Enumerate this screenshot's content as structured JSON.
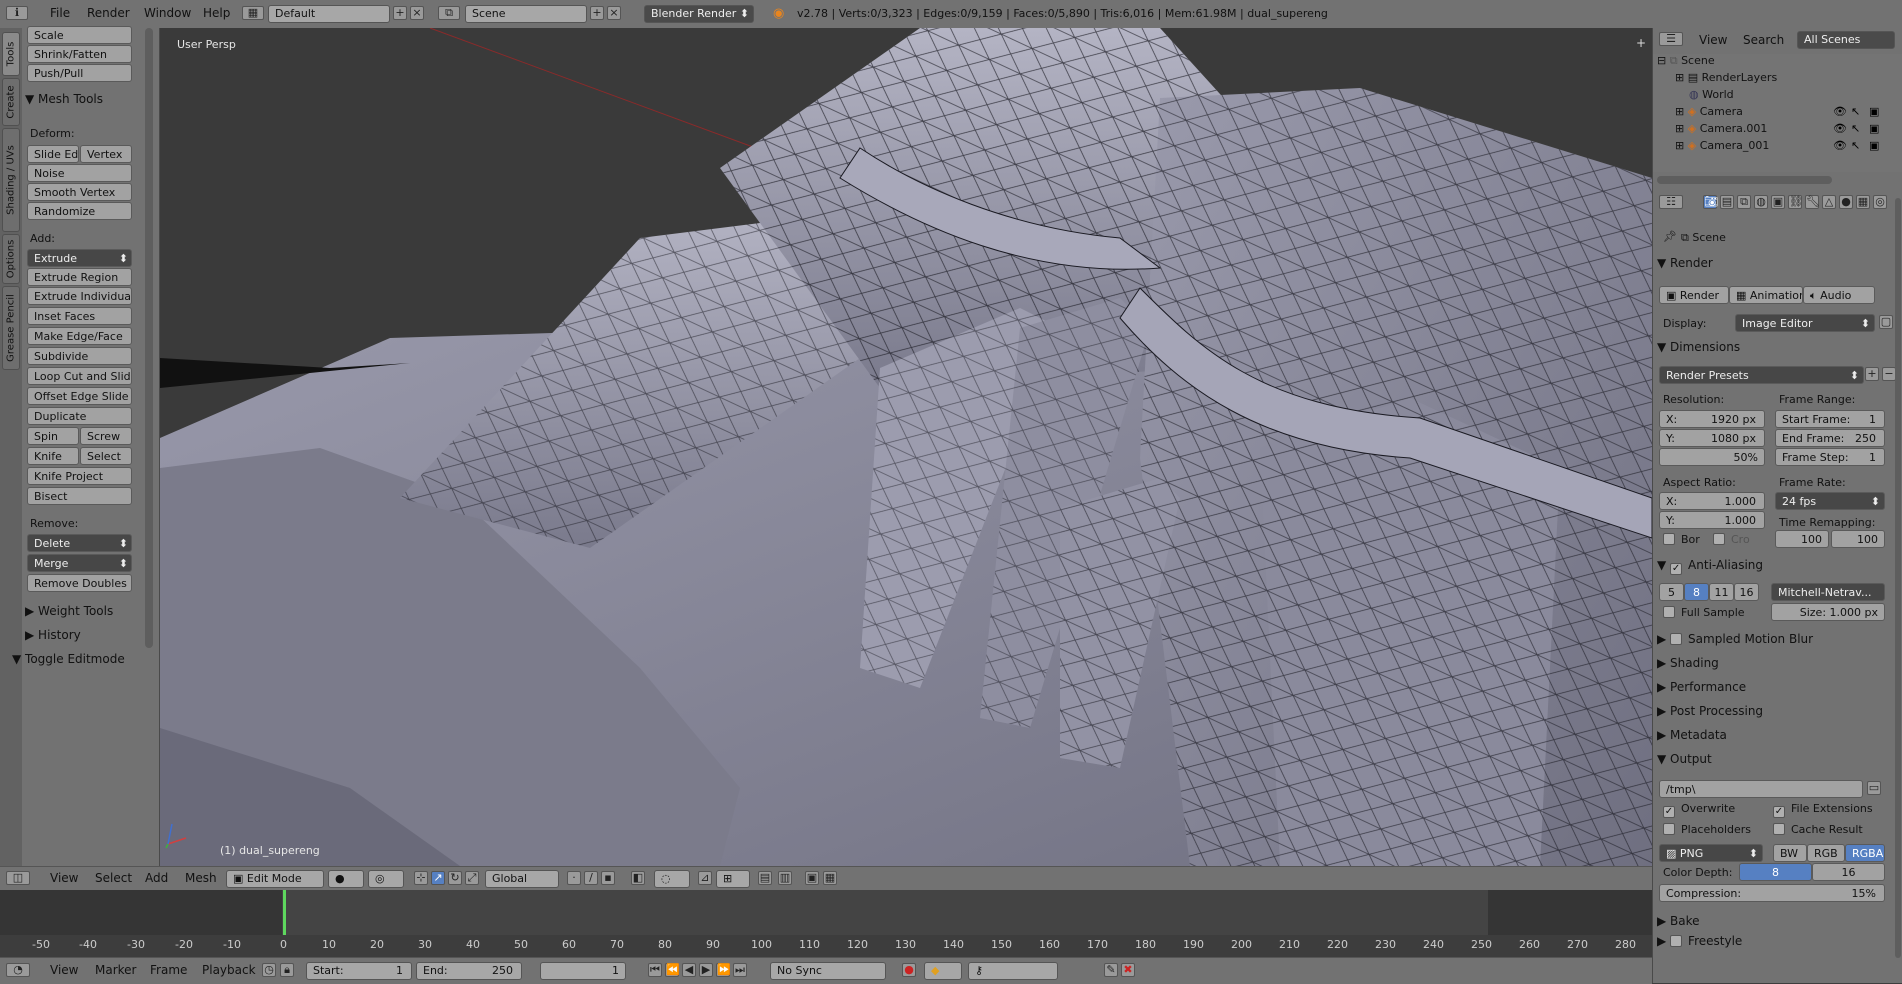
{
  "topbar": {
    "menus": [
      "File",
      "Render",
      "Window",
      "Help"
    ],
    "layout": "Default",
    "scene": "Scene",
    "engine": "Blender Render",
    "stats": "v2.78 | Verts:0/3,323 | Edges:0/9,159 | Faces:0/5,890 | Tris:6,016 | Mem:61.98M | dual_supereng"
  },
  "tabs": [
    "Tools",
    "Create",
    "Shading / UVs",
    "Options",
    "Grease Pencil"
  ],
  "toolshelf": {
    "top_buttons": [
      "Scale",
      "Shrink/Fatten",
      "Push/Pull"
    ],
    "mesh_tools_header": "Mesh Tools",
    "deform_label": "Deform:",
    "slide_edge": "Slide Ed",
    "vertex": "Vertex",
    "noise": "Noise",
    "smooth_vertex": "Smooth Vertex",
    "randomize": "Randomize",
    "add_label": "Add:",
    "extrude": "Extrude",
    "extrude_region": "Extrude Region",
    "extrude_individual": "Extrude Individual",
    "inset_faces": "Inset Faces",
    "make_edge_face": "Make Edge/Face",
    "subdivide": "Subdivide",
    "loop_cut": "Loop Cut and Slide",
    "offset_edge": "Offset Edge Slide",
    "duplicate": "Duplicate",
    "spin": "Spin",
    "screw": "Screw",
    "knife": "Knife",
    "select": "Select",
    "knife_project": "Knife Project",
    "bisect": "Bisect",
    "remove_label": "Remove:",
    "delete": "Delete",
    "merge": "Merge",
    "remove_doubles": "Remove Doubles",
    "weight_tools": "Weight Tools",
    "history": "History",
    "toggle_editmode": "Toggle Editmode"
  },
  "viewport": {
    "view_label": "User Persp",
    "object_label": "(1) dual_supereng"
  },
  "view3d_header": {
    "menus": [
      "View",
      "Select",
      "Add",
      "Mesh"
    ],
    "mode": "Edit Mode",
    "orientation": "Global"
  },
  "timeline": {
    "ticks": [
      "-50",
      "-40",
      "-30",
      "-20",
      "-10",
      "0",
      "10",
      "20",
      "30",
      "40",
      "50",
      "60",
      "70",
      "80",
      "90",
      "100",
      "110",
      "120",
      "130",
      "140",
      "150",
      "160",
      "170",
      "180",
      "190",
      "200",
      "210",
      "220",
      "230",
      "240",
      "250",
      "260",
      "270",
      "280"
    ],
    "menus": [
      "View",
      "Marker",
      "Frame",
      "Playback"
    ],
    "start_label": "Start:",
    "start_value": "1",
    "end_label": "End:",
    "end_value": "250",
    "current": "1",
    "sync": "No Sync"
  },
  "outliner": {
    "menus": [
      "View",
      "Search"
    ],
    "filter": "All Scenes",
    "items": [
      "Scene",
      "RenderLayers",
      "World",
      "Camera",
      "Camera.001",
      "Camera_001"
    ]
  },
  "props": {
    "breadcrumb": "Scene",
    "render_header": "Render",
    "render_btn": "Render",
    "animation_btn": "Animation",
    "audio_btn": "Audio",
    "display_label": "Display:",
    "display_value": "Image Editor",
    "dimensions_header": "Dimensions",
    "presets": "Render Presets",
    "resolution_label": "Resolution:",
    "res_x": "X:",
    "res_x_val": "1920 px",
    "res_y": "Y:",
    "res_y_val": "1080 px",
    "res_pct": "50%",
    "frame_range_label": "Frame Range:",
    "start_frame": "Start Frame:",
    "start_frame_val": "1",
    "end_frame": "End Frame:",
    "end_frame_val": "250",
    "frame_step": "Frame Step:",
    "frame_step_val": "1",
    "aspect_label": "Aspect Ratio:",
    "asp_x": "X:",
    "asp_x_val": "1.000",
    "asp_y": "Y:",
    "asp_y_val": "1.000",
    "frame_rate_label": "Frame Rate:",
    "frame_rate": "24 fps",
    "border": "Bor",
    "crop": "Cro",
    "time_remap_label": "Time Remapping:",
    "remap_old": "100",
    "remap_new": "100",
    "aa_header": "Anti-Aliasing",
    "aa_samples": [
      "5",
      "8",
      "11",
      "16"
    ],
    "aa_filter": "Mitchell-Netrav...",
    "full_sample": "Full Sample",
    "aa_size": "Size: 1.000 px",
    "motion_blur": "Sampled Motion Blur",
    "shading": "Shading",
    "performance": "Performance",
    "post_processing": "Post Processing",
    "metadata": "Metadata",
    "output_header": "Output",
    "output_path": "/tmp\\",
    "overwrite": "Overwrite",
    "file_extensions": "File Extensions",
    "placeholders": "Placeholders",
    "cache_result": "Cache Result",
    "format": "PNG",
    "bw": "BW",
    "rgb": "RGB",
    "rgba": "RGBA",
    "color_depth_label": "Color Depth:",
    "depth_8": "8",
    "depth_16": "16",
    "compression": "Compression:",
    "compression_val": "15%",
    "bake": "Bake",
    "freestyle": "Freestyle"
  }
}
